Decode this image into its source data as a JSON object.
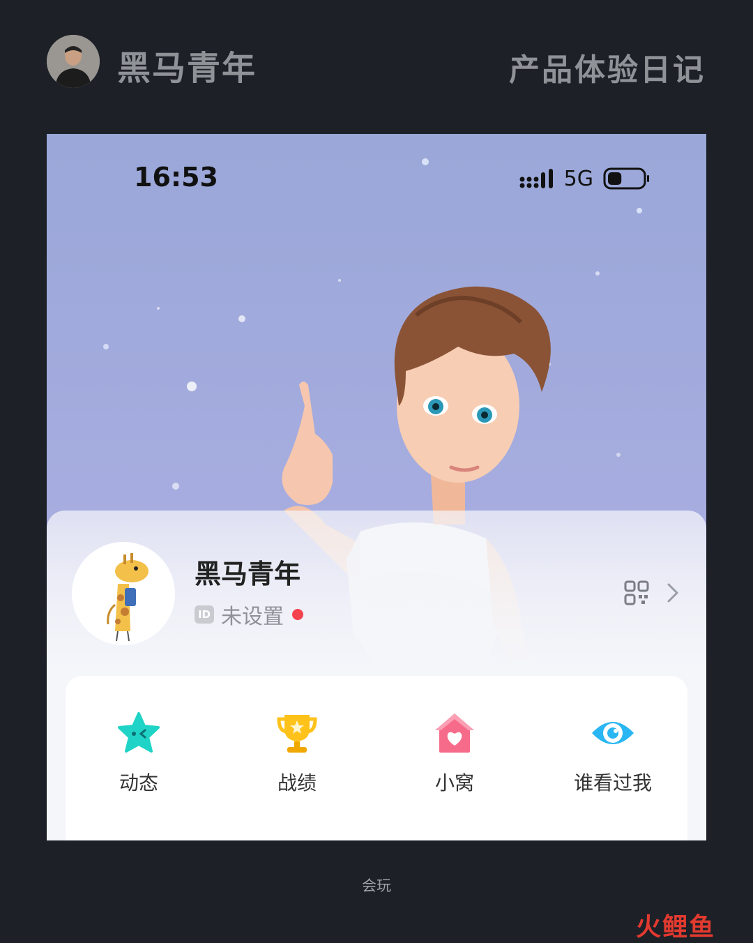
{
  "header": {
    "author_name": "黑马青年",
    "series_title": "产品体验日记"
  },
  "status_bar": {
    "time": "16:53",
    "network": "5G",
    "battery_fraction": 0.4
  },
  "profile": {
    "nickname": "黑马青年",
    "id_badge": "ID",
    "id_status": "未设置",
    "id_dot_color": "#f5424f"
  },
  "quick_actions": [
    {
      "label": "动态",
      "icon": "star-icon",
      "color": "#1fd4c6"
    },
    {
      "label": "战绩",
      "icon": "trophy-icon",
      "color": "#ffc21a"
    },
    {
      "label": "小窝",
      "icon": "home-heart-icon",
      "color": "#f76b8a"
    },
    {
      "label": "谁看过我",
      "icon": "eye-icon",
      "color": "#29b6f2"
    }
  ],
  "caption": "会玩",
  "watermark": "火鲤鱼"
}
